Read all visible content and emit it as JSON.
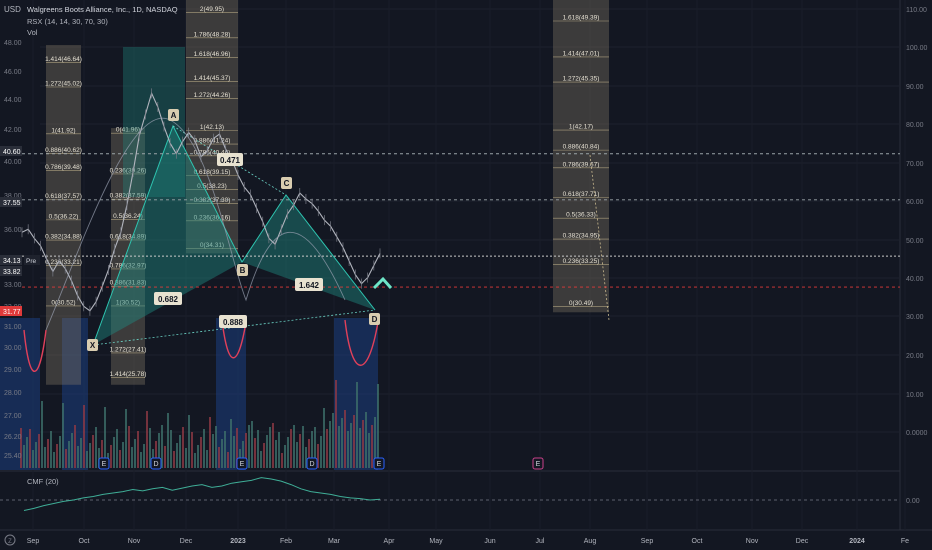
{
  "header": {
    "currency": "USD",
    "title": "Walgreens Boots Alliance, Inc., 1D, NASDAQ",
    "indicator_rsi": "RSX (14, 14, 30, 70, 30)",
    "indicator_vol": "Vol",
    "cmf_label": "CMF (20)"
  },
  "colors": {
    "background": "#131722",
    "price_line": "#b2b5be",
    "pattern_fill": "#1f8a80",
    "fib_box": "#8a7f6a",
    "rsi_box": "#1a3a78",
    "rsi_line": "#e0405a",
    "support_line": "#e03a3a",
    "accent": "#26a69a"
  },
  "badges": {
    "r1": "40.60",
    "r2": "37.55",
    "cur": "34.13",
    "cur_tag": "Pre",
    "cur2": "33.82",
    "sup": "31.77"
  },
  "pattern": {
    "points": [
      "X",
      "A",
      "B",
      "C",
      "D"
    ],
    "ratios": [
      "0.682",
      "0.471",
      "1.642",
      "0.888"
    ]
  },
  "event_markers": [
    "E",
    "D",
    "E",
    "D",
    "E",
    "E"
  ],
  "bottom_left_icon": "Z",
  "chart_data": [
    {
      "type": "line",
      "title": "Walgreens Boots Alliance, Inc., 1D, NASDAQ",
      "ylabel": "USD",
      "x_ticks": [
        "Sep",
        "Oct",
        "Nov",
        "Dec",
        "2023",
        "Feb",
        "Mar",
        "Apr",
        "May",
        "Jun",
        "Jul",
        "Aug",
        "Sep",
        "Oct",
        "Nov",
        "Dec",
        "2024",
        "Fe"
      ],
      "y_ticks": [
        "48.00",
        "46.00",
        "44.00",
        "42.00",
        "40.00",
        "38.00",
        "36.00",
        "34.00",
        "33.00",
        "32.00",
        "31.00",
        "30.00",
        "29.00",
        "28.00",
        "27.00",
        "26.20",
        "25.40"
      ],
      "right_ticks": [
        "110.00",
        "100.00",
        "90.00",
        "80.00",
        "70.00",
        "60.00",
        "50.00",
        "40.00",
        "30.00",
        "20.00",
        "10.00",
        "0.0000"
      ],
      "close_approx": [
        35.4,
        35.6,
        35.0,
        34.5,
        33.6,
        32.8,
        33.5,
        33.0,
        32.2,
        31.2,
        30.5,
        30.2,
        30.8,
        31.8,
        32.9,
        34.3,
        35.4,
        37.2,
        39.4,
        41.8,
        43.2,
        44.6,
        43.7,
        42.4,
        41.3,
        40.6,
        41.4,
        42.0,
        41.5,
        40.4,
        40.8,
        41.6,
        41.9,
        40.9,
        40.2,
        39.2,
        38.4,
        37.9,
        37.0,
        36.1,
        35.0,
        34.6,
        35.6,
        36.6,
        37.2,
        38.0,
        37.6,
        37.3,
        36.8,
        36.2,
        35.8,
        35.1,
        34.4,
        33.5,
        32.6,
        32.0,
        32.4,
        33.2,
        34.0
      ],
      "xabcd": [
        {
          "label": "X",
          "value": 30.52
        },
        {
          "label": "A",
          "value": 41.96
        },
        {
          "label": "B",
          "value": 34.31
        },
        {
          "label": "C",
          "value": 37.9
        },
        {
          "label": "D",
          "value": 31.77
        }
      ],
      "fib_levels": [
        {
          "label": "1.414(46.64)",
          "value": 46.64
        },
        {
          "label": "1.272(45.02)",
          "value": 45.02
        },
        {
          "label": "1(41.92)",
          "value": 41.92
        },
        {
          "label": "0.886(40.62)",
          "value": 40.62
        },
        {
          "label": "0.786(39.48)",
          "value": 39.48
        },
        {
          "label": "0.618(37.57)",
          "value": 37.57
        },
        {
          "label": "0.5(36.22)",
          "value": 36.22
        },
        {
          "label": "0.382(34.88)",
          "value": 34.88
        },
        {
          "label": "0.236(33.21)",
          "value": 33.21
        },
        {
          "label": "0(30.52)",
          "value": 30.52
        }
      ],
      "fib_mid": [
        {
          "label": "0(41.96)",
          "value": 41.96
        },
        {
          "label": "0.236(39.26)",
          "value": 39.26
        },
        {
          "label": "0.382(37.59)",
          "value": 37.59
        },
        {
          "label": "0.5(36.24)",
          "value": 36.24
        },
        {
          "label": "0.618(34.89)",
          "value": 34.89
        },
        {
          "label": "0.786(32.97)",
          "value": 32.97
        },
        {
          "label": "0.886(31.83)",
          "value": 31.83
        },
        {
          "label": "1(30.52)",
          "value": 30.52
        },
        {
          "label": "1.272(27.41)",
          "value": 27.41
        },
        {
          "label": "1.414(25.78)",
          "value": 25.78
        }
      ],
      "fib_top": [
        {
          "label": "2(49.95)",
          "value": 49.95
        },
        {
          "label": "1.786(48.28)",
          "value": 48.28
        },
        {
          "label": "1.618(46.96)",
          "value": 46.96
        },
        {
          "label": "1.414(45.37)",
          "value": 45.37
        },
        {
          "label": "1.272(44.26)",
          "value": 44.26
        },
        {
          "label": "1(42.13)",
          "value": 42.13
        },
        {
          "label": "0.886(41.24)",
          "value": 41.24
        },
        {
          "label": "0.786(40.46)",
          "value": 40.46
        },
        {
          "label": "0.618(39.15)",
          "value": 39.15
        },
        {
          "label": "0.5(38.23)",
          "value": 38.23
        },
        {
          "label": "0.382(37.30)",
          "value": 37.3
        },
        {
          "label": "0.236(36.16)",
          "value": 36.16
        },
        {
          "label": "0(34.31)",
          "value": 34.31
        }
      ],
      "fib_right": [
        {
          "label": "1.618(49.39)",
          "value": 49.39
        },
        {
          "label": "1.414(47.01)",
          "value": 47.01
        },
        {
          "label": "1.272(45.35)",
          "value": 45.35
        },
        {
          "label": "1(42.17)",
          "value": 42.17
        },
        {
          "label": "0.886(40.84)",
          "value": 40.84
        },
        {
          "label": "0.786(39.67)",
          "value": 39.67
        },
        {
          "label": "0.618(37.71)",
          "value": 37.71
        },
        {
          "label": "0.5(36.33)",
          "value": 36.33
        },
        {
          "label": "0.382(34.95)",
          "value": 34.95
        },
        {
          "label": "0.236(33.25)",
          "value": 33.25
        },
        {
          "label": "0(30.49)",
          "value": 30.49
        }
      ],
      "horizontal_levels": [
        40.6,
        37.55,
        33.82,
        31.77
      ]
    },
    {
      "type": "line",
      "title": "CMF (20)",
      "y_ticks": [
        "0.00"
      ],
      "values_approx": [
        -0.15,
        -0.12,
        -0.08,
        -0.05,
        -0.02,
        0.0,
        0.03,
        0.05,
        0.08,
        0.1,
        0.12,
        0.15,
        0.13,
        0.16,
        0.18,
        0.14,
        0.17,
        0.2,
        0.22,
        0.18,
        0.2,
        0.24,
        0.26,
        0.28,
        0.32,
        0.3,
        0.27,
        0.22,
        0.16,
        0.12,
        0.1,
        0.08,
        0.05,
        0.03,
        0.02,
        0.0,
        0.01
      ]
    }
  ]
}
